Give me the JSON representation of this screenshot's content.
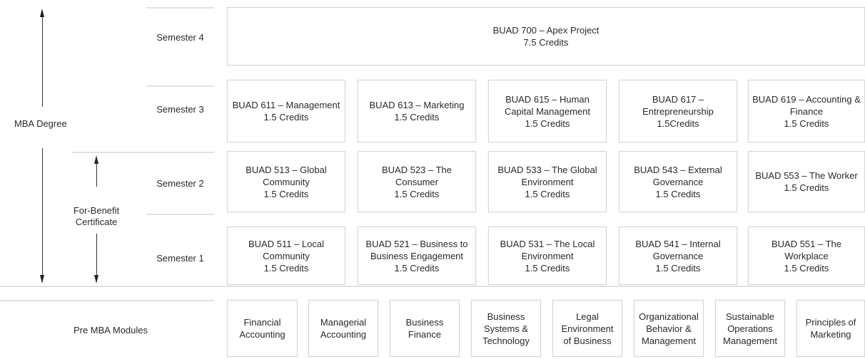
{
  "labels": {
    "mba_degree": "MBA Degree",
    "for_benefit": [
      "For-Benefit",
      "Certificate"
    ],
    "pre_mba": "Pre MBA Modules"
  },
  "semesters": {
    "s4": "Semester 4",
    "s3": "Semester 3",
    "s2": "Semester 2",
    "s1": "Semester 1"
  },
  "apex": {
    "title": "BUAD 700 – Apex Project",
    "credits": "7.5 Credits"
  },
  "sem3": [
    {
      "lines": [
        "BUAD 611 – Management"
      ],
      "credits": "1.5 Credits"
    },
    {
      "lines": [
        "BUAD 613 – Marketing"
      ],
      "credits": "1.5 Credits"
    },
    {
      "lines": [
        "BUAD 615 – Human",
        "Capital Management"
      ],
      "credits": "1.5 Credits"
    },
    {
      "lines": [
        "BUAD 617 –",
        "Entrepreneurship"
      ],
      "credits": "1.5Credits"
    },
    {
      "lines": [
        "BUAD 619 – Accounting &",
        "Finance"
      ],
      "credits": "1.5 Credits"
    }
  ],
  "sem2": [
    {
      "lines": [
        "BUAD 513 – Global",
        "Community"
      ],
      "credits": "1.5 Credits"
    },
    {
      "lines": [
        "BUAD 523 – The",
        "Consumer"
      ],
      "credits": "1.5 Credits"
    },
    {
      "lines": [
        "BUAD 533 – The Global",
        "Environment"
      ],
      "credits": "1.5 Credits"
    },
    {
      "lines": [
        "BUAD 543 – External",
        "Governance"
      ],
      "credits": "1.5 Credits"
    },
    {
      "lines": [
        "BUAD 553 – The Worker"
      ],
      "credits": "1.5 Credits"
    }
  ],
  "sem1": [
    {
      "lines": [
        "BUAD 511 – Local",
        "Community"
      ],
      "credits": "1.5 Credits"
    },
    {
      "lines": [
        "BUAD 521 – Business to",
        "Business Engagement"
      ],
      "credits": "1.5 Credits"
    },
    {
      "lines": [
        "BUAD 531 – The Local",
        "Environment"
      ],
      "credits": "1.5 Credits"
    },
    {
      "lines": [
        "BUAD 541 – Internal",
        "Governance"
      ],
      "credits": "1.5 Credits"
    },
    {
      "lines": [
        "BUAD 551 – The",
        "Workplace"
      ],
      "credits": "1.5 Credits"
    }
  ],
  "pre_modules": [
    [
      "Financial",
      "Accounting"
    ],
    [
      "Managerial",
      "Accounting"
    ],
    [
      "Business",
      "Finance"
    ],
    [
      "Business",
      "Systems &",
      "Technology"
    ],
    [
      "Legal",
      "Environment",
      "of Business"
    ],
    [
      "Organizational",
      "Behavior &",
      "Management"
    ],
    [
      "Sustainable",
      "Operations",
      "Management"
    ],
    [
      "Principles of",
      "Marketing"
    ]
  ]
}
